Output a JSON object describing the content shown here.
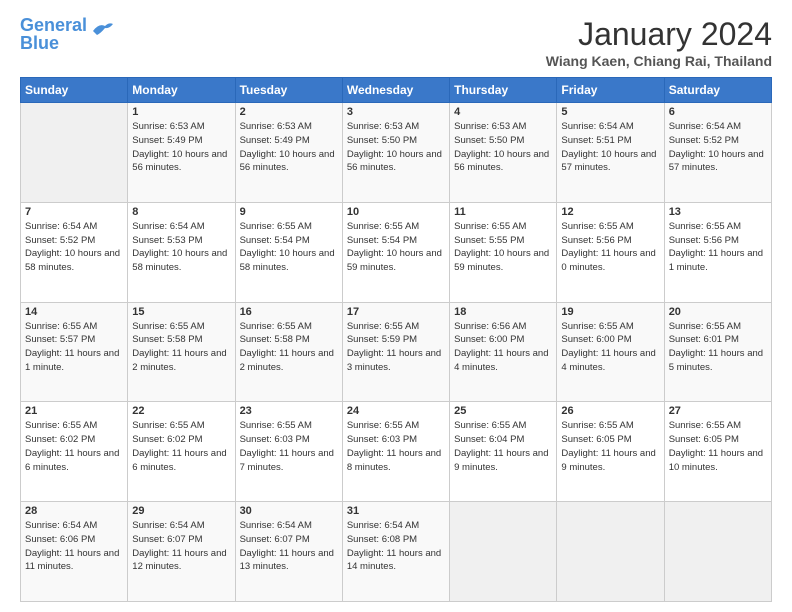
{
  "header": {
    "logo_line1": "General",
    "logo_line2": "Blue",
    "month": "January 2024",
    "location": "Wiang Kaen, Chiang Rai, Thailand"
  },
  "weekdays": [
    "Sunday",
    "Monday",
    "Tuesday",
    "Wednesday",
    "Thursday",
    "Friday",
    "Saturday"
  ],
  "weeks": [
    [
      {
        "day": "",
        "sunrise": "",
        "sunset": "",
        "daylight": ""
      },
      {
        "day": "1",
        "sunrise": "Sunrise: 6:53 AM",
        "sunset": "Sunset: 5:49 PM",
        "daylight": "Daylight: 10 hours and 56 minutes."
      },
      {
        "day": "2",
        "sunrise": "Sunrise: 6:53 AM",
        "sunset": "Sunset: 5:49 PM",
        "daylight": "Daylight: 10 hours and 56 minutes."
      },
      {
        "day": "3",
        "sunrise": "Sunrise: 6:53 AM",
        "sunset": "Sunset: 5:50 PM",
        "daylight": "Daylight: 10 hours and 56 minutes."
      },
      {
        "day": "4",
        "sunrise": "Sunrise: 6:53 AM",
        "sunset": "Sunset: 5:50 PM",
        "daylight": "Daylight: 10 hours and 56 minutes."
      },
      {
        "day": "5",
        "sunrise": "Sunrise: 6:54 AM",
        "sunset": "Sunset: 5:51 PM",
        "daylight": "Daylight: 10 hours and 57 minutes."
      },
      {
        "day": "6",
        "sunrise": "Sunrise: 6:54 AM",
        "sunset": "Sunset: 5:52 PM",
        "daylight": "Daylight: 10 hours and 57 minutes."
      }
    ],
    [
      {
        "day": "7",
        "sunrise": "Sunrise: 6:54 AM",
        "sunset": "Sunset: 5:52 PM",
        "daylight": "Daylight: 10 hours and 58 minutes."
      },
      {
        "day": "8",
        "sunrise": "Sunrise: 6:54 AM",
        "sunset": "Sunset: 5:53 PM",
        "daylight": "Daylight: 10 hours and 58 minutes."
      },
      {
        "day": "9",
        "sunrise": "Sunrise: 6:55 AM",
        "sunset": "Sunset: 5:54 PM",
        "daylight": "Daylight: 10 hours and 58 minutes."
      },
      {
        "day": "10",
        "sunrise": "Sunrise: 6:55 AM",
        "sunset": "Sunset: 5:54 PM",
        "daylight": "Daylight: 10 hours and 59 minutes."
      },
      {
        "day": "11",
        "sunrise": "Sunrise: 6:55 AM",
        "sunset": "Sunset: 5:55 PM",
        "daylight": "Daylight: 10 hours and 59 minutes."
      },
      {
        "day": "12",
        "sunrise": "Sunrise: 6:55 AM",
        "sunset": "Sunset: 5:56 PM",
        "daylight": "Daylight: 11 hours and 0 minutes."
      },
      {
        "day": "13",
        "sunrise": "Sunrise: 6:55 AM",
        "sunset": "Sunset: 5:56 PM",
        "daylight": "Daylight: 11 hours and 1 minute."
      }
    ],
    [
      {
        "day": "14",
        "sunrise": "Sunrise: 6:55 AM",
        "sunset": "Sunset: 5:57 PM",
        "daylight": "Daylight: 11 hours and 1 minute."
      },
      {
        "day": "15",
        "sunrise": "Sunrise: 6:55 AM",
        "sunset": "Sunset: 5:58 PM",
        "daylight": "Daylight: 11 hours and 2 minutes."
      },
      {
        "day": "16",
        "sunrise": "Sunrise: 6:55 AM",
        "sunset": "Sunset: 5:58 PM",
        "daylight": "Daylight: 11 hours and 2 minutes."
      },
      {
        "day": "17",
        "sunrise": "Sunrise: 6:55 AM",
        "sunset": "Sunset: 5:59 PM",
        "daylight": "Daylight: 11 hours and 3 minutes."
      },
      {
        "day": "18",
        "sunrise": "Sunrise: 6:56 AM",
        "sunset": "Sunset: 6:00 PM",
        "daylight": "Daylight: 11 hours and 4 minutes."
      },
      {
        "day": "19",
        "sunrise": "Sunrise: 6:55 AM",
        "sunset": "Sunset: 6:00 PM",
        "daylight": "Daylight: 11 hours and 4 minutes."
      },
      {
        "day": "20",
        "sunrise": "Sunrise: 6:55 AM",
        "sunset": "Sunset: 6:01 PM",
        "daylight": "Daylight: 11 hours and 5 minutes."
      }
    ],
    [
      {
        "day": "21",
        "sunrise": "Sunrise: 6:55 AM",
        "sunset": "Sunset: 6:02 PM",
        "daylight": "Daylight: 11 hours and 6 minutes."
      },
      {
        "day": "22",
        "sunrise": "Sunrise: 6:55 AM",
        "sunset": "Sunset: 6:02 PM",
        "daylight": "Daylight: 11 hours and 6 minutes."
      },
      {
        "day": "23",
        "sunrise": "Sunrise: 6:55 AM",
        "sunset": "Sunset: 6:03 PM",
        "daylight": "Daylight: 11 hours and 7 minutes."
      },
      {
        "day": "24",
        "sunrise": "Sunrise: 6:55 AM",
        "sunset": "Sunset: 6:03 PM",
        "daylight": "Daylight: 11 hours and 8 minutes."
      },
      {
        "day": "25",
        "sunrise": "Sunrise: 6:55 AM",
        "sunset": "Sunset: 6:04 PM",
        "daylight": "Daylight: 11 hours and 9 minutes."
      },
      {
        "day": "26",
        "sunrise": "Sunrise: 6:55 AM",
        "sunset": "Sunset: 6:05 PM",
        "daylight": "Daylight: 11 hours and 9 minutes."
      },
      {
        "day": "27",
        "sunrise": "Sunrise: 6:55 AM",
        "sunset": "Sunset: 6:05 PM",
        "daylight": "Daylight: 11 hours and 10 minutes."
      }
    ],
    [
      {
        "day": "28",
        "sunrise": "Sunrise: 6:54 AM",
        "sunset": "Sunset: 6:06 PM",
        "daylight": "Daylight: 11 hours and 11 minutes."
      },
      {
        "day": "29",
        "sunrise": "Sunrise: 6:54 AM",
        "sunset": "Sunset: 6:07 PM",
        "daylight": "Daylight: 11 hours and 12 minutes."
      },
      {
        "day": "30",
        "sunrise": "Sunrise: 6:54 AM",
        "sunset": "Sunset: 6:07 PM",
        "daylight": "Daylight: 11 hours and 13 minutes."
      },
      {
        "day": "31",
        "sunrise": "Sunrise: 6:54 AM",
        "sunset": "Sunset: 6:08 PM",
        "daylight": "Daylight: 11 hours and 14 minutes."
      },
      {
        "day": "",
        "sunrise": "",
        "sunset": "",
        "daylight": ""
      },
      {
        "day": "",
        "sunrise": "",
        "sunset": "",
        "daylight": ""
      },
      {
        "day": "",
        "sunrise": "",
        "sunset": "",
        "daylight": ""
      }
    ]
  ]
}
